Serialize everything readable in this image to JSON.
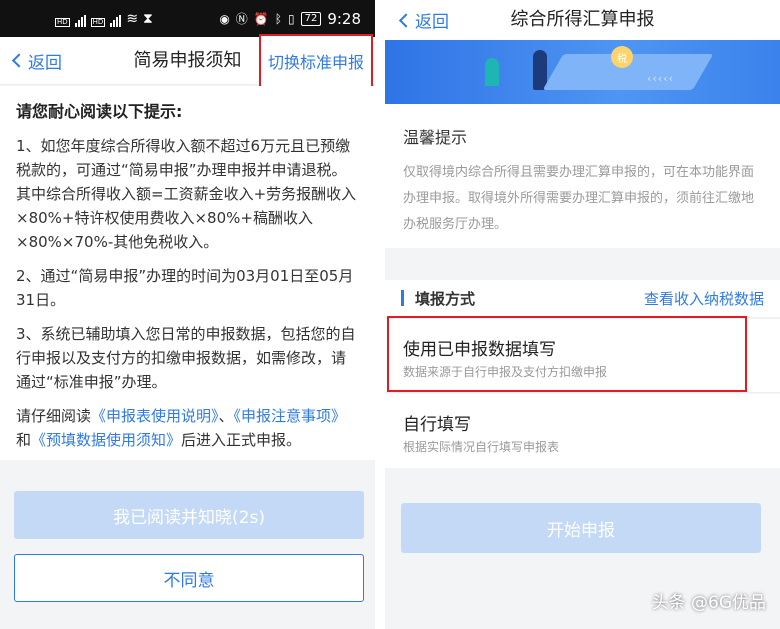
{
  "left": {
    "status": {
      "time": "9:28",
      "battery": "72"
    },
    "nav": {
      "back_label": "返回",
      "title": "简易申报须知",
      "switch_label": "切换标准申报"
    },
    "body": {
      "heading": "请您耐心阅读以下提示:",
      "p1": "1、如您年度综合所得收入额不超过6万元且已预缴税款的，可通过“简易申报”办理申报并申请退税。其中综合所得收入额=工资薪金收入+劳务报酬收入×80%+特许权使用费收入×80%+稿酬收入×80%×70%-其他免税收入。",
      "p2": "2、通过“简易申报”办理的时间为03月01日至05月31日。",
      "p3": "3、系统已辅助填入您日常的申报数据，包括您的自行申报以及支付方的扣缴申报数据，如需修改，请通过“标准申报”办理。",
      "p4_pre": "请仔细阅读",
      "link1": "《申报表使用说明》",
      "p4_sep1": "、",
      "link2": "《申报注意事项》",
      "p4_and": "和",
      "link3": "《预填数据使用须知》",
      "p4_post": "后进入正式申报。"
    },
    "read_button": "我已阅读并知晓(2s)",
    "disagree_button": "不同意"
  },
  "right": {
    "nav": {
      "back_label": "返回",
      "title": "综合所得汇算申报"
    },
    "banner": {
      "coin_text": "税"
    },
    "tips": {
      "title": "温馨提示",
      "body": "仅取得境内综合所得且需要办理汇算申报的，可在本功能界面办理申报。取得境外所得需要办理汇算申报的，须前往汇缴地办税服务厅办理。"
    },
    "fill": {
      "label": "填报方式",
      "link": "查看收入纳税数据"
    },
    "options": [
      {
        "title": "使用已申报数据填写",
        "subtitle": "数据来源于自行申报及支付方扣缴申报"
      },
      {
        "title": "自行填写",
        "subtitle": "根据实际情况自行填写申报表"
      }
    ],
    "start_button": "开始申报"
  },
  "watermark": "头条 @6G优品",
  "colors": {
    "accent": "#2f7be5",
    "highlight_border": "#e11c23",
    "disabled_button": "#c3d9f6"
  }
}
